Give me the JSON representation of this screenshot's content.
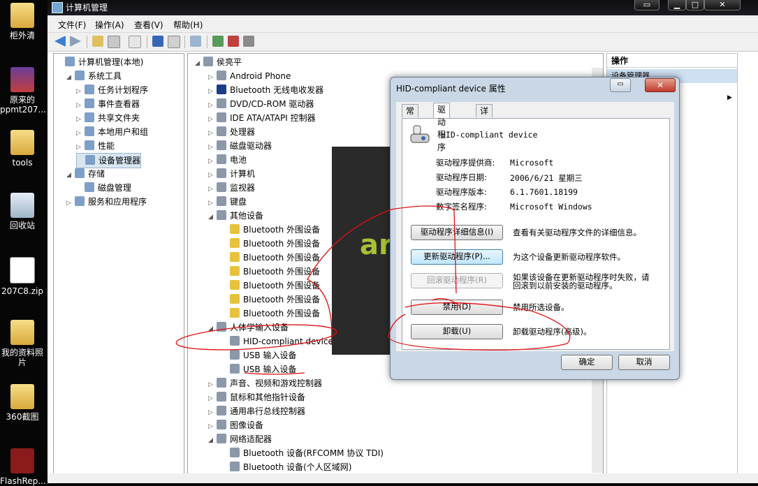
{
  "desktop": {
    "icons": [
      {
        "label": "柜外清",
        "icon": "folder-icon"
      },
      {
        "label": "原来的ppmt207...",
        "icon": "rar-archive-icon"
      },
      {
        "label": "tools",
        "icon": "folder-icon"
      },
      {
        "label": "回收站",
        "icon": "recycle-bin-icon"
      },
      {
        "label": "207C8.zip",
        "icon": "zip-file-icon"
      },
      {
        "label": "我的资料照片",
        "icon": "folder-icon"
      },
      {
        "label": "360截图",
        "icon": "folder-icon"
      },
      {
        "label": "FlashRep...",
        "icon": "flash-app-icon"
      }
    ]
  },
  "window": {
    "title": "计算机管理",
    "buttons": {
      "minimize": "▁",
      "maximize": "□",
      "close": "✕"
    }
  },
  "menu": [
    "文件(F)",
    "操作(A)",
    "查看(V)",
    "帮助(H)"
  ],
  "left_tree": [
    {
      "label": "计算机管理(本地)",
      "exp": "",
      "icon": "computer-management-icon"
    },
    {
      "label": "系统工具",
      "exp": "◢",
      "icon": "tools-icon"
    },
    {
      "label": "任务计划程序",
      "exp": "▷",
      "icon": "clock-icon"
    },
    {
      "label": "事件查看器",
      "exp": "▷",
      "icon": "event-viewer-icon"
    },
    {
      "label": "共享文件夹",
      "exp": "▷",
      "icon": "shared-folder-icon"
    },
    {
      "label": "本地用户和组",
      "exp": "▷",
      "icon": "users-icon"
    },
    {
      "label": "性能",
      "exp": "▷",
      "icon": "performance-icon"
    },
    {
      "label": "设备管理器",
      "exp": "",
      "icon": "device-manager-icon"
    },
    {
      "label": "存储",
      "exp": "◢",
      "icon": "storage-icon"
    },
    {
      "label": "磁盘管理",
      "exp": "",
      "icon": "disk-management-icon"
    },
    {
      "label": "服务和应用程序",
      "exp": "▷",
      "icon": "services-icon"
    }
  ],
  "device_tree": [
    {
      "label": "侯亮平",
      "exp": "◢",
      "icon": "computer-icon"
    },
    {
      "label": "Android Phone",
      "exp": "▷",
      "icon": "phone-icon"
    },
    {
      "label": "Bluetooth 无线电收发器",
      "exp": "▷",
      "icon": "bluetooth-icon"
    },
    {
      "label": "DVD/CD-ROM 驱动器",
      "exp": "▷",
      "icon": "dvd-icon"
    },
    {
      "label": "IDE ATA/ATAPI 控制器",
      "exp": "▷",
      "icon": "ide-icon"
    },
    {
      "label": "处理器",
      "exp": "▷",
      "icon": "cpu-icon"
    },
    {
      "label": "磁盘驱动器",
      "exp": "▷",
      "icon": "disk-icon"
    },
    {
      "label": "电池",
      "exp": "▷",
      "icon": "battery-icon"
    },
    {
      "label": "计算机",
      "exp": "▷",
      "icon": "computer-icon"
    },
    {
      "label": "监视器",
      "exp": "▷",
      "icon": "monitor-icon"
    },
    {
      "label": "键盘",
      "exp": "▷",
      "icon": "keyboard-icon"
    },
    {
      "label": "其他设备",
      "exp": "◢",
      "icon": "unknown-device-icon"
    },
    {
      "label": "Bluetooth 外围设备",
      "exp": "",
      "icon": "warning-device-icon"
    },
    {
      "label": "Bluetooth 外围设备",
      "exp": "",
      "icon": "warning-device-icon"
    },
    {
      "label": "Bluetooth 外围设备",
      "exp": "",
      "icon": "warning-device-icon"
    },
    {
      "label": "Bluetooth 外围设备",
      "exp": "",
      "icon": "warning-device-icon"
    },
    {
      "label": "Bluetooth 外围设备",
      "exp": "",
      "icon": "warning-device-icon"
    },
    {
      "label": "Bluetooth 外围设备",
      "exp": "",
      "icon": "warning-device-icon"
    },
    {
      "label": "Bluetooth 外围设备",
      "exp": "",
      "icon": "warning-device-icon"
    },
    {
      "label": "人体学输入设备",
      "exp": "◢",
      "icon": "hid-icon"
    },
    {
      "label": "HID-compliant device",
      "exp": "",
      "icon": "hid-device-icon"
    },
    {
      "label": "USB 输入设备",
      "exp": "",
      "icon": "usb-input-icon"
    },
    {
      "label": "USB 输入设备",
      "exp": "",
      "icon": "usb-input-icon"
    },
    {
      "label": "声音、视频和游戏控制器",
      "exp": "▷",
      "icon": "sound-icon"
    },
    {
      "label": "鼠标和其他指针设备",
      "exp": "▷",
      "icon": "mouse-icon"
    },
    {
      "label": "通用串行总线控制器",
      "exp": "▷",
      "icon": "usb-controller-icon"
    },
    {
      "label": "图像设备",
      "exp": "▷",
      "icon": "camera-icon"
    },
    {
      "label": "网络适配器",
      "exp": "◢",
      "icon": "network-icon"
    },
    {
      "label": "Bluetooth 设备(RFCOMM 协议 TDI)",
      "exp": "",
      "icon": "network-adapter-icon"
    },
    {
      "label": "Bluetooth 设备(个人区域网)",
      "exp": "",
      "icon": "network-adapter-icon"
    }
  ],
  "actions": {
    "header": "操作",
    "sub": "设备管理器"
  },
  "overlay_text": "ar",
  "dialog": {
    "title": "HID-compliant device 属性",
    "tabs": [
      "常规",
      "驱动程序",
      "详细信息"
    ],
    "device_name": "HID-compliant device",
    "props": [
      {
        "label": "驱动程序提供商:",
        "value": "Microsoft"
      },
      {
        "label": "驱动程序日期:",
        "value": "2006/6/21 星期三"
      },
      {
        "label": "驱动程序版本:",
        "value": "6.1.7601.18199"
      },
      {
        "label": "数字签名程序:",
        "value": "Microsoft Windows"
      }
    ],
    "actions": [
      {
        "button": "驱动程序详细信息(I)",
        "desc": "查看有关驱动程序文件的详细信息。"
      },
      {
        "button": "更新驱动程序(P)...",
        "desc": "为这个设备更新驱动程序软件。"
      },
      {
        "button": "回滚驱动程序(R)",
        "desc_line1": "如果该设备在更新驱动程序时失败，请",
        "desc_line2": "回滚到以前安装的驱动程序。"
      },
      {
        "button": "禁用(D)",
        "desc": "禁用所选设备。"
      },
      {
        "button": "卸载(U)",
        "desc": "卸载驱动程序(高级)。"
      }
    ],
    "ok": "确定",
    "cancel": "取消"
  },
  "colors": {
    "annotation": "#e01010",
    "selection": "#d8e6f2"
  }
}
